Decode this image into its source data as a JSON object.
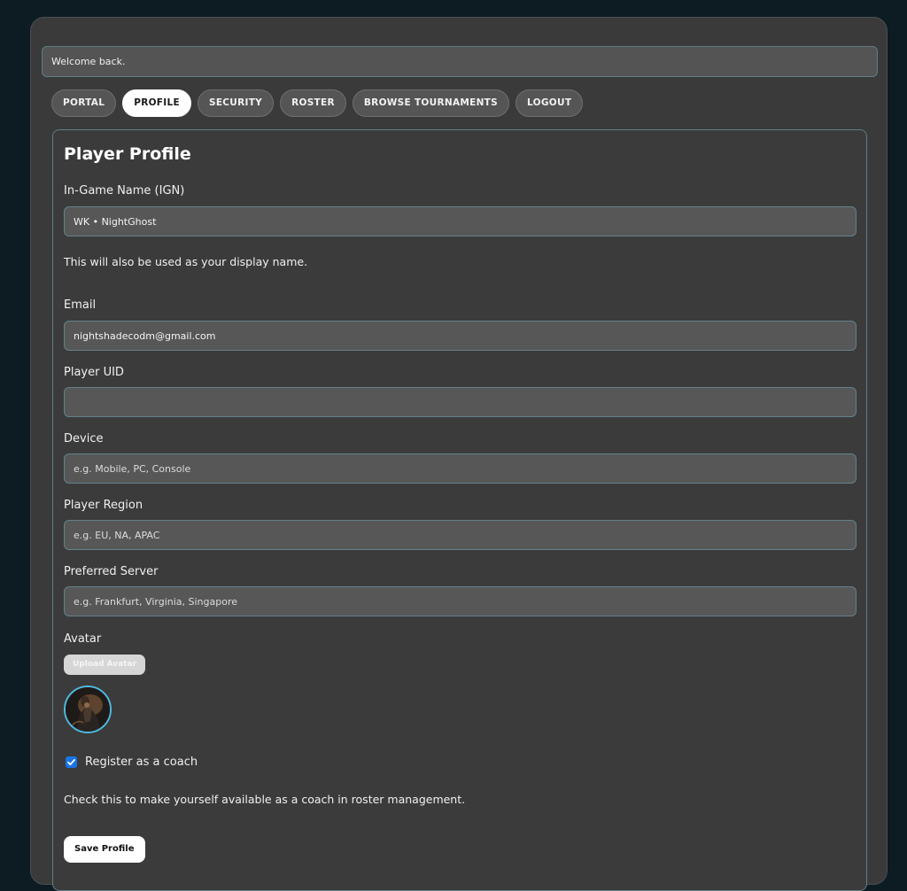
{
  "welcome": {
    "text": "Welcome back."
  },
  "tabs": [
    {
      "label": "PORTAL",
      "active": false
    },
    {
      "label": "PROFILE",
      "active": true
    },
    {
      "label": "SECURITY",
      "active": false
    },
    {
      "label": "ROSTER",
      "active": false
    },
    {
      "label": "BROWSE TOURNAMENTS",
      "active": false
    },
    {
      "label": "LOGOUT",
      "active": false
    }
  ],
  "profile": {
    "title": "Player Profile",
    "ign": {
      "label": "In-Game Name (IGN)",
      "value": "WK • NightGhost",
      "help": "This will also be used as your display name."
    },
    "email": {
      "label": "Email",
      "value": "nightshadecodm@gmail.com"
    },
    "uid": {
      "label": "Player UID",
      "value": ""
    },
    "device": {
      "label": "Device",
      "placeholder": "e.g. Mobile, PC, Console"
    },
    "region": {
      "label": "Player Region",
      "placeholder": "e.g. EU, NA, APAC"
    },
    "server": {
      "label": "Preferred Server",
      "placeholder": "e.g. Frankfurt, Virginia, Singapore"
    },
    "avatar": {
      "label": "Avatar",
      "upload_label": "Upload Avatar"
    },
    "coach": {
      "checked": true,
      "label": "Register as a coach",
      "help": "Check this to make yourself available as a coach in roster management."
    },
    "save_label": "Save Profile"
  },
  "colors": {
    "page_bg": "#0d1b22",
    "panel_bg": "#3a3a3a",
    "field_border": "#65808c",
    "checkbox_accent": "#1a73e8",
    "avatar_ring": "#4fb8e0"
  },
  "icons": {
    "checkbox": "checkmark-icon"
  }
}
